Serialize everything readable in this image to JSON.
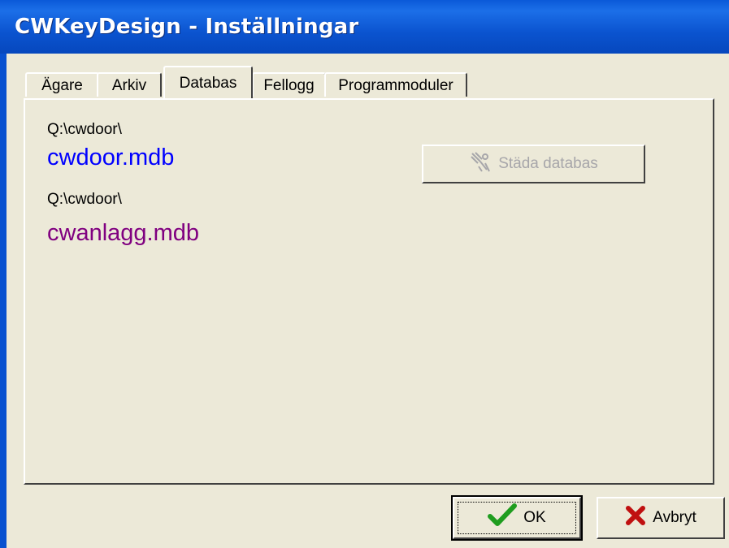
{
  "window": {
    "title": "CWKeyDesign - Inställningar"
  },
  "tabs": [
    {
      "label": "Ägare"
    },
    {
      "label": "Arkiv"
    },
    {
      "label": "Databas",
      "active": true
    },
    {
      "label": "Fellogg"
    },
    {
      "label": "Programmoduler"
    }
  ],
  "databas": {
    "db1_path": "Q:\\cwdoor\\",
    "db1_name": "cwdoor.mdb",
    "db1_color": "#0000ff",
    "db2_path": "Q:\\cwdoor\\",
    "db2_name": "cwanlagg.mdb",
    "db2_color": "#800080",
    "clean_button_label": "Städa databas",
    "clean_button_icon": "broom-tools-icon"
  },
  "footer": {
    "ok_label": "OK",
    "ok_icon": "checkmark-icon",
    "cancel_label": "Avbryt",
    "cancel_icon": "x-icon"
  }
}
